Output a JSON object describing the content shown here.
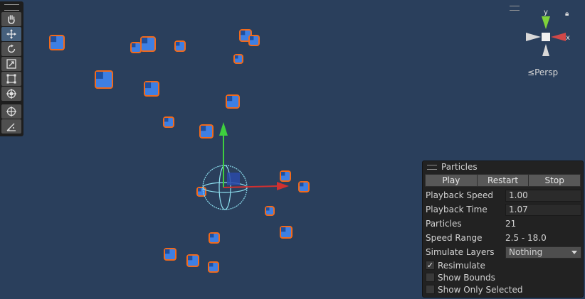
{
  "toolbar": {
    "tools": [
      {
        "icon": "hand-icon",
        "active": false
      },
      {
        "icon": "move-icon",
        "active": true
      },
      {
        "icon": "rotate-icon",
        "active": false
      },
      {
        "icon": "scale-icon",
        "active": false
      },
      {
        "icon": "rect-icon",
        "active": false
      },
      {
        "icon": "transform-icon",
        "active": false
      },
      {
        "icon": "custom-transform-icon",
        "active": false
      },
      {
        "icon": "particle-editor-icon",
        "active": false
      }
    ]
  },
  "gizmo": {
    "y_label": "y",
    "x_label": "x",
    "projection_label": "Persp",
    "projection_icon": "≤"
  },
  "particles_panel": {
    "title": "Particles",
    "buttons": {
      "play": "Play",
      "restart": "Restart",
      "stop": "Stop"
    },
    "playback_speed": {
      "label": "Playback Speed",
      "value": "1.00"
    },
    "playback_time": {
      "label": "Playback Time",
      "value": "1.07"
    },
    "particles": {
      "label": "Particles",
      "value": "21"
    },
    "speed_range": {
      "label": "Speed Range",
      "value": "2.5 - 18.0"
    },
    "simulate_layers": {
      "label": "Simulate Layers",
      "value": "Nothing"
    },
    "resimulate": {
      "label": "Resimulate",
      "checked": true
    },
    "show_bounds": {
      "label": "Show Bounds",
      "checked": false
    },
    "show_only_selected": {
      "label": "Show Only Selected",
      "checked": false
    }
  },
  "colors": {
    "background": "#2a3f5c",
    "particle_fill": "#3e7fe3",
    "selection_outline": "#f26a1b",
    "x_axis": "#d03030",
    "y_axis": "#3ecf3e",
    "emitter_wire": "#8ee0f0"
  }
}
